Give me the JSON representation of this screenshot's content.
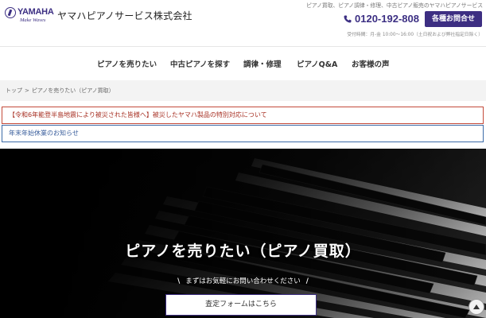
{
  "header": {
    "logo": {
      "wordmark": "YAMAHA",
      "slogan": "Make Waves"
    },
    "company_name": "ヤマハピアノサービス株式会社",
    "tagline": "ピアノ買取、ピアノ調律・修理、中古ピアノ販売のヤマハピアノサービス",
    "phone": "0120-192-808",
    "contact_button": "各種お問合せ",
    "hours": "受付時間：月-金 10:00〜16:00（土日祝および弊社指定日除く）",
    "brand_color": "#3d2e82"
  },
  "nav": {
    "items": [
      "ピアノを売りたい",
      "中古ピアノを探す",
      "調律・修理",
      "ピアノQ&A",
      "お客様の声"
    ]
  },
  "breadcrumb": {
    "home": "トップ",
    "separator": ">",
    "current": "ピアノを売りたい（ピアノ買取）"
  },
  "notices": [
    {
      "text": "【令和6年能登半島地震により被災された皆様へ】被災したヤマハ製品の特別対応について",
      "color": "#a72f22"
    },
    {
      "text": "年末年始休業のお知らせ",
      "color": "#3b5f9d"
    }
  ],
  "hero": {
    "title": "ピアノを売りたい（ピアノ買取）",
    "subtitle": "まずはお気軽にお問い合わせください",
    "slash_left": "\\",
    "slash_right": "/",
    "form_button": "査定フォームはこちら"
  },
  "icons": {
    "phone": "phone-icon",
    "scroll_top": "arrow-up-icon",
    "logo": "tuning-fork-icon"
  }
}
